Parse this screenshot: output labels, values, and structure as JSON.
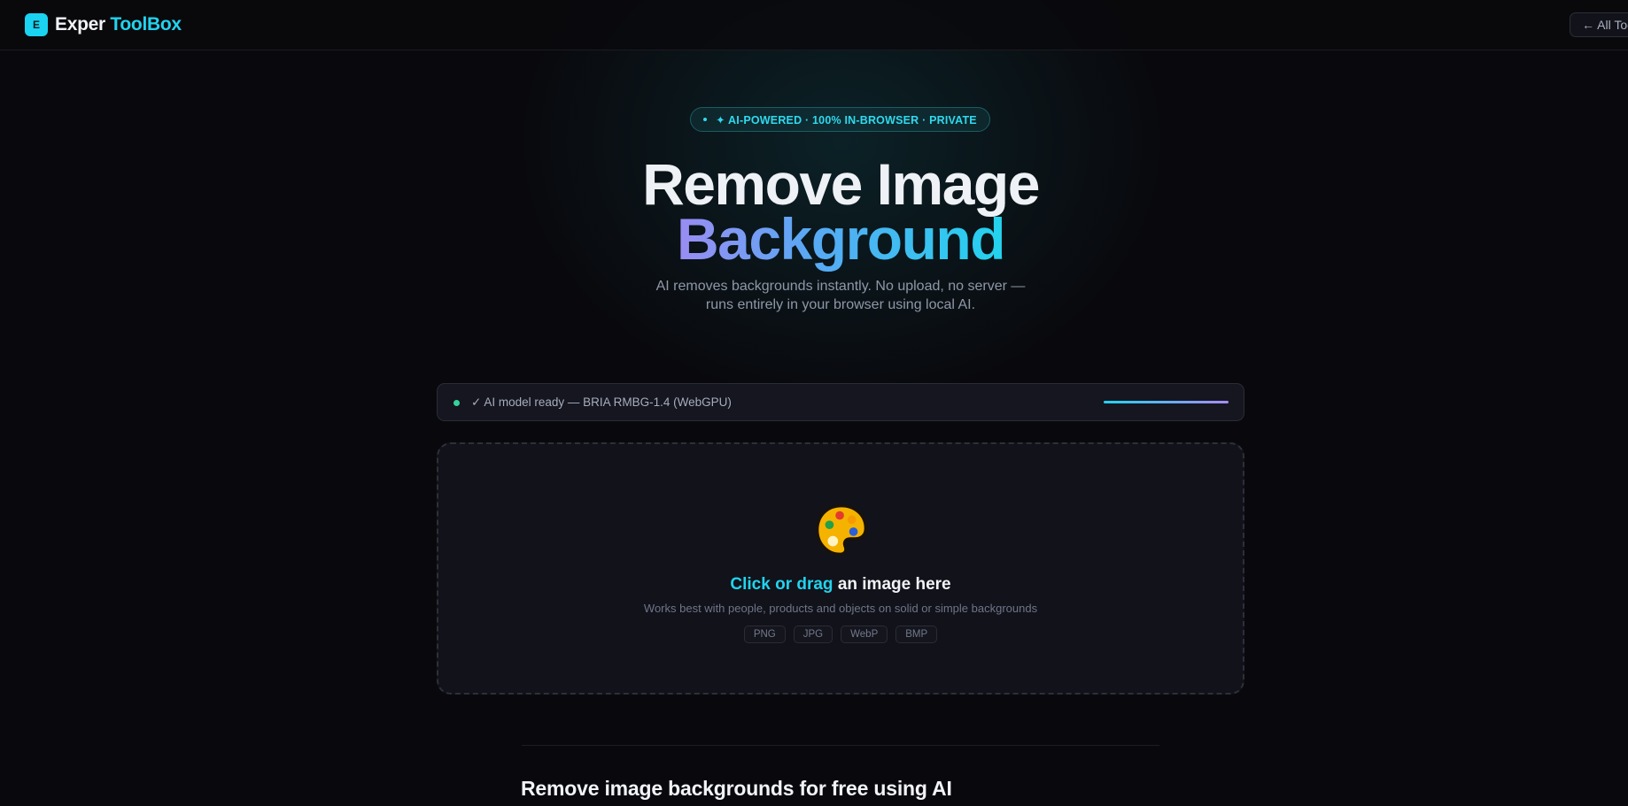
{
  "header": {
    "logo_letter": "E",
    "brand_part1": "Exper",
    "brand_part2": "ToolBox",
    "all_tools_label": "← All Tools"
  },
  "hero": {
    "badge": "✦ AI-POWERED · 100% IN-BROWSER · PRIVATE",
    "title_line1": "Remove Image",
    "title_line2": "Background",
    "subtitle": "AI removes backgrounds instantly. No upload, no server — runs entirely in your browser using local AI."
  },
  "status": {
    "text": "✓ AI model ready — BRIA RMBG-1.4 (WebGPU)",
    "progress": 1.0,
    "indicator_color": "#34d399"
  },
  "dropzone": {
    "icon": "palette-icon",
    "title_accent": "Click or drag",
    "title_rest": " an image here",
    "subtitle": "Works best with people, products and objects on solid or simple backgrounds",
    "formats": [
      "PNG",
      "JPG",
      "WebP",
      "BMP"
    ]
  },
  "content": {
    "heading": "Remove image backgrounds for free using AI"
  },
  "colors": {
    "accent": "#22d3ee",
    "background": "#09090d"
  }
}
